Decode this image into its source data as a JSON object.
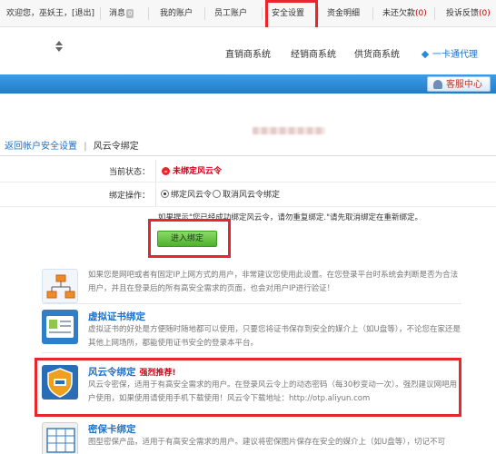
{
  "topbar": {
    "welcome_prefix": "欢迎您，",
    "username": "巫妖王",
    "logout": "[退出]",
    "messages_label": "消息",
    "messages_count": "0",
    "my_account": "我的账户",
    "employee_account": "员工账户",
    "security_settings": "安全设置",
    "funds_detail": "资金明细",
    "unpaid_label": "未还欠款",
    "unpaid_count": "(0)",
    "complaints_label": "投诉反馈",
    "complaints_count": "(0)"
  },
  "nav": {
    "items": [
      "直销商系统",
      "经销商系统",
      "供货商系统"
    ],
    "active": "一卡通代理"
  },
  "service_center": "客服中心",
  "breadcrumb": {
    "back_link": "返回帐户安全设置",
    "separator": "|",
    "current": "风云令绑定"
  },
  "form": {
    "status_label": "当前状态：",
    "status_value": "未绑定风云令",
    "operation_label": "绑定操作：",
    "option_bind": "绑定风云令",
    "option_unbind": "取消风云令绑定",
    "hint": "如果提示\"您已经成功绑定风云令，请勿重复绑定.\"请先取消绑定在重新绑定。",
    "enter_button": "进入绑定"
  },
  "features": [
    {
      "icon": "network-icon",
      "title": "",
      "hot": "",
      "desc": "如果您是网吧或者有固定IP上网方式的用户，非常建议您使用此设置。在您登录平台时系统会判断是否为合法用户，并且在登录后的所有高安全需求的页面，也会对用户IP进行验证！"
    },
    {
      "icon": "certificate-icon",
      "title": "虚拟证书绑定",
      "hot": "",
      "desc": "虚拟证书的好处是方便随时随地都可以使用，只要您将证书保存到安全的媒介上（如U盘等），不论您在家还是其他上网场所，都能使用证书安全的登录本平台。"
    },
    {
      "icon": "token-icon",
      "title": "风云令绑定",
      "hot": "强烈推荐!",
      "desc": "风云令密保，适用于有高安全需求的用户。在登录风云令上的动态密码（每30秒变动一次）。强烈建议网吧用户使用，如果使用请使用手机下载使用！风云令下载地址：http://otp.aliyun.com"
    },
    {
      "icon": "card-icon",
      "title": "密保卡绑定",
      "hot": "",
      "desc": "图型密保产品，适用于有高安全需求的用户。建议将密保图片保存在安全的媒介上（如U盘等），切记不可"
    }
  ]
}
